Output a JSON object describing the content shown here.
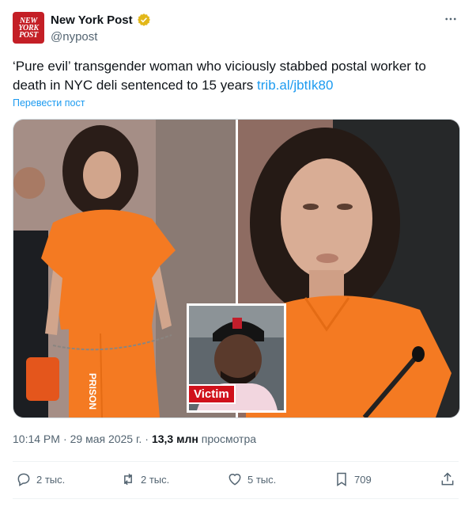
{
  "account": {
    "name": "New York Post",
    "handle": "@nypost",
    "logo_lines": [
      "NEW",
      "YORK",
      "POST"
    ],
    "verified": true
  },
  "tweet": {
    "text": "‘Pure evil’ transgender woman who viciously stabbed postal worker to death in NYC deli sentenced to 15 years",
    "link": "trib.al/jbtIk80",
    "translate_label": "Перевести пост"
  },
  "media": {
    "inset_badge": "Victim",
    "garment_text": "PRISON"
  },
  "meta": {
    "time": "10:14 PM",
    "separator": "·",
    "date": "29 мая 2025 г.",
    "views_count": "13,3 млн",
    "views_label": "просмотра"
  },
  "actions": {
    "replies": "2 тыс.",
    "reposts": "2 тыс.",
    "likes": "5 тыс.",
    "bookmarks": "709"
  },
  "colors": {
    "accent": "#1d9bf0",
    "brand_red": "#c41f26",
    "muted_text": "#536471",
    "victim_red": "#d0111b"
  }
}
